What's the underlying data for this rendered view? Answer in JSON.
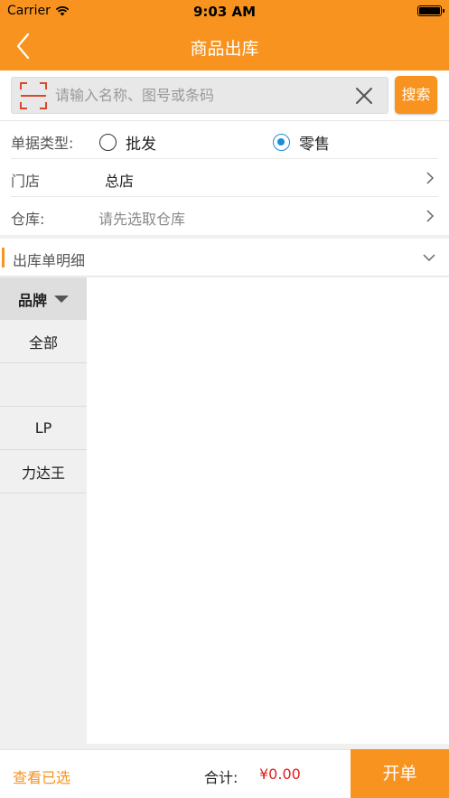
{
  "status_bar": {
    "carrier": "Carrier",
    "time": "9:03 AM"
  },
  "nav": {
    "title": "商品出库"
  },
  "search": {
    "placeholder": "请输入名称、图号或条码",
    "button_label": "搜索"
  },
  "form": {
    "doc_type_label": "单据类型:",
    "doc_type_options": [
      {
        "label": "批发",
        "selected": false
      },
      {
        "label": "零售",
        "selected": true
      }
    ],
    "store_label": "门店",
    "store_value": "总店",
    "warehouse_label": "仓库:",
    "warehouse_placeholder": "请先选取仓库"
  },
  "section": {
    "title": "出库单明细"
  },
  "sidebar": {
    "header": "品牌",
    "items": [
      "全部",
      "",
      "LP",
      "力达王"
    ]
  },
  "footer": {
    "view_selected": "查看已选",
    "total_label": "合计:",
    "total_value": "¥0.00",
    "submit_label": "开单"
  },
  "colors": {
    "accent": "#f7931e",
    "radio_selected": "#1c8ed6",
    "price": "#e02020"
  }
}
